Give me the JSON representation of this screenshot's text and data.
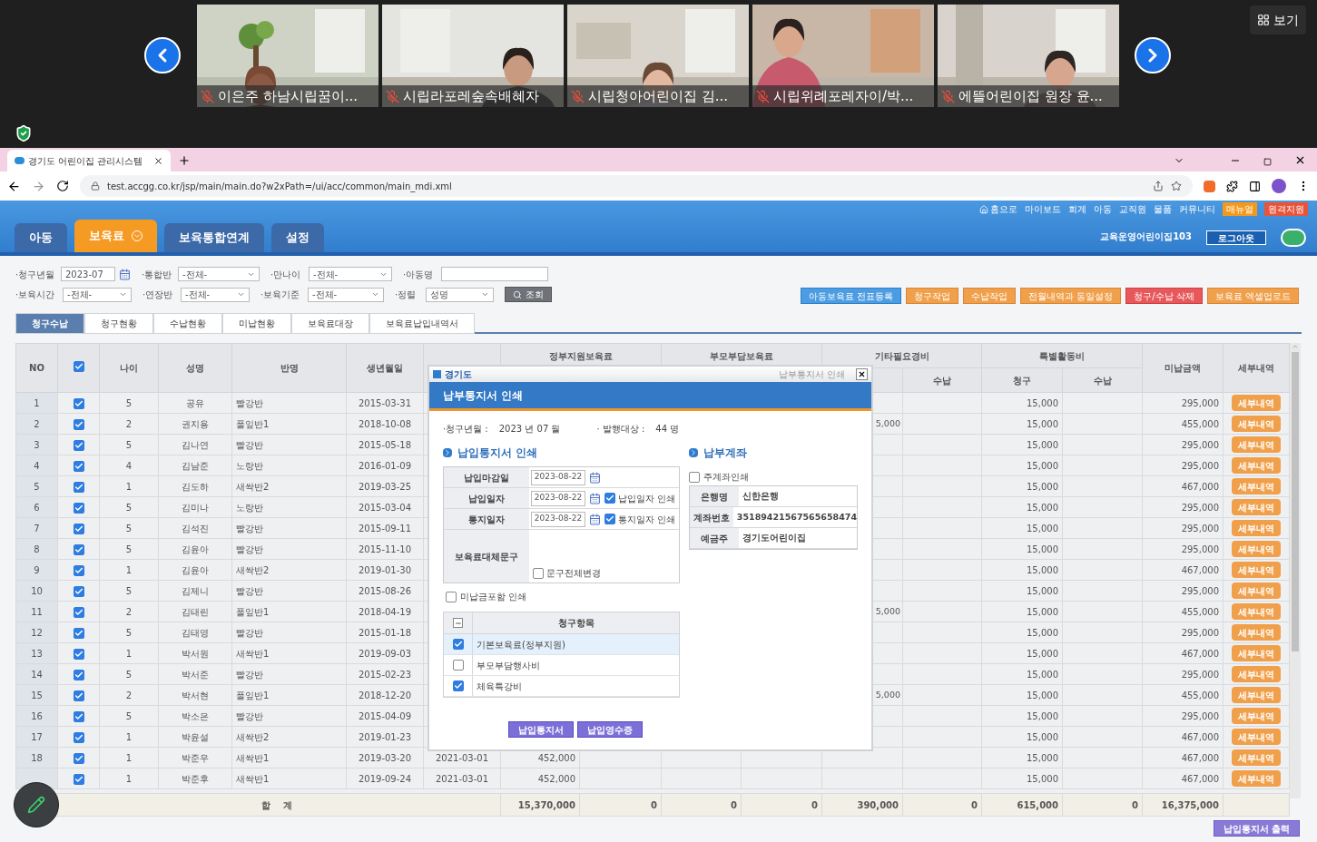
{
  "video_strip": {
    "tiles": [
      {
        "name": "이은주 하남시립꿈이...",
        "muted": true
      },
      {
        "name": "시립라포레숲속배혜자",
        "muted": true
      },
      {
        "name": "시립청아어린이집 김...",
        "muted": true
      },
      {
        "name": "시립위례포레자이/박...",
        "muted": true
      },
      {
        "name": "에뜰어린이집 원장 윤...",
        "muted": true
      }
    ],
    "view_button": "보기"
  },
  "browser": {
    "tab_title": "경기도 어린이집 관리시스템",
    "url": "test.accgg.co.kr/jsp/main/main.do?w2xPath=/ui/acc/common/main_mdi.xml"
  },
  "top_links": [
    {
      "label": "홈으로",
      "kind": "home"
    },
    {
      "label": "마이보드",
      "kind": "plain"
    },
    {
      "label": "회계",
      "kind": "plain"
    },
    {
      "label": "아동",
      "kind": "plain"
    },
    {
      "label": "교직원",
      "kind": "plain"
    },
    {
      "label": "물품",
      "kind": "plain"
    },
    {
      "label": "커뮤니티",
      "kind": "plain"
    },
    {
      "label": "매뉴얼",
      "kind": "orange"
    },
    {
      "label": "원격지원",
      "kind": "red"
    }
  ],
  "main_tabs": [
    {
      "label": "아동",
      "selected": false
    },
    {
      "label": "보육료",
      "selected": true
    },
    {
      "label": "보육통합연계",
      "selected": false
    },
    {
      "label": "설정",
      "selected": false
    }
  ],
  "org_name": "교육운영어린이집103",
  "logout": "로그아웃",
  "filters": [
    [
      {
        "label": "·청구년월",
        "kind": "month",
        "value": "2023-07"
      },
      {
        "label": "·통합반",
        "kind": "select",
        "value": "-전체-"
      },
      {
        "label": "·만나이",
        "kind": "select",
        "value": "-전체-"
      },
      {
        "label": "·아동명",
        "kind": "text"
      }
    ],
    [
      {
        "label": "·보육시간",
        "kind": "select",
        "value": "-전체-"
      },
      {
        "label": "·연장반",
        "kind": "select",
        "value": "-전체-"
      },
      {
        "label": "·보육기준",
        "kind": "select",
        "value": "-전체-"
      },
      {
        "label": "·정렬",
        "kind": "select",
        "value": "성명"
      }
    ]
  ],
  "search_button": "조회",
  "action_buttons": [
    {
      "label": "아동보육료 전표등록",
      "kind": "blue"
    },
    {
      "label": "청구작업",
      "kind": "orange"
    },
    {
      "label": "수납작업",
      "kind": "orange"
    },
    {
      "label": "전월내역과 동일설정",
      "kind": "orange"
    },
    {
      "label": "청구/수납 삭제",
      "kind": "red"
    },
    {
      "label": "보육료 엑셀업로드",
      "kind": "orange"
    }
  ],
  "sub_tabs": [
    {
      "label": "청구수납",
      "selected": true
    },
    {
      "label": "청구현황",
      "selected": false
    },
    {
      "label": "수납현황",
      "selected": false
    },
    {
      "label": "미납현황",
      "selected": false
    },
    {
      "label": "보육료대장",
      "selected": false
    },
    {
      "label": "보육료납입내역서",
      "selected": false
    }
  ],
  "table": {
    "columns": {
      "no": "NO",
      "select_all_checked": true,
      "age": "나이",
      "name": "성명",
      "class": "반명",
      "birth": "생년월일",
      "gov": "정부지원보육료",
      "parent": "부모부담보육료",
      "etc": "기타필요경비",
      "etc_paid": "수납",
      "special": "특별활동비",
      "special_charge": "청구",
      "special_paid": "수납",
      "unpaid": "미납금액",
      "detail": "세부내역"
    },
    "rows": [
      {
        "no": "1",
        "checked": true,
        "age": "5",
        "name": "공유",
        "class": "빨강반",
        "birth": "2015-03-31",
        "special_charge": "15,000",
        "unpaid": "295,000",
        "detail": "세부내역"
      },
      {
        "no": "2",
        "checked": true,
        "age": "2",
        "name": "권지용",
        "class": "풀잎반1",
        "birth": "2018-10-08",
        "etc_charge": "5,000",
        "special_charge": "15,000",
        "unpaid": "455,000",
        "detail": "세부내역"
      },
      {
        "no": "3",
        "checked": true,
        "age": "5",
        "name": "김나연",
        "class": "빨강반",
        "birth": "2015-05-18",
        "special_charge": "15,000",
        "unpaid": "295,000",
        "detail": "세부내역"
      },
      {
        "no": "4",
        "checked": true,
        "age": "4",
        "name": "김남준",
        "class": "노랑반",
        "birth": "2016-01-09",
        "special_charge": "15,000",
        "unpaid": "295,000",
        "detail": "세부내역"
      },
      {
        "no": "5",
        "checked": true,
        "age": "1",
        "name": "김도하",
        "class": "새싹반2",
        "birth": "2019-03-25",
        "special_charge": "15,000",
        "unpaid": "467,000",
        "detail": "세부내역"
      },
      {
        "no": "6",
        "checked": true,
        "age": "5",
        "name": "김미나",
        "class": "노랑반",
        "birth": "2015-03-04",
        "special_charge": "15,000",
        "unpaid": "295,000",
        "detail": "세부내역"
      },
      {
        "no": "7",
        "checked": true,
        "age": "5",
        "name": "김석진",
        "class": "빨강반",
        "birth": "2015-09-11",
        "special_charge": "15,000",
        "unpaid": "295,000",
        "detail": "세부내역"
      },
      {
        "no": "8",
        "checked": true,
        "age": "5",
        "name": "김윤아",
        "class": "빨강반",
        "birth": "2015-11-10",
        "special_charge": "15,000",
        "unpaid": "295,000",
        "detail": "세부내역"
      },
      {
        "no": "9",
        "checked": true,
        "age": "1",
        "name": "김윤아",
        "class": "새싹반2",
        "birth": "2019-01-30",
        "special_charge": "15,000",
        "unpaid": "467,000",
        "detail": "세부내역"
      },
      {
        "no": "10",
        "checked": true,
        "age": "5",
        "name": "김제니",
        "class": "빨강반",
        "birth": "2015-08-26",
        "special_charge": "15,000",
        "unpaid": "295,000",
        "detail": "세부내역"
      },
      {
        "no": "11",
        "checked": true,
        "age": "2",
        "name": "김태린",
        "class": "풀잎반1",
        "birth": "2018-04-19",
        "etc_charge": "5,000",
        "special_charge": "15,000",
        "unpaid": "455,000",
        "detail": "세부내역"
      },
      {
        "no": "12",
        "checked": true,
        "age": "5",
        "name": "김태영",
        "class": "빨강반",
        "birth": "2015-01-18",
        "special_charge": "15,000",
        "unpaid": "295,000",
        "detail": "세부내역"
      },
      {
        "no": "13",
        "checked": true,
        "age": "1",
        "name": "박서원",
        "class": "새싹반1",
        "birth": "2019-09-03",
        "special_charge": "15,000",
        "unpaid": "467,000",
        "detail": "세부내역"
      },
      {
        "no": "14",
        "checked": true,
        "age": "5",
        "name": "박서준",
        "class": "빨강반",
        "birth": "2015-02-23",
        "special_charge": "15,000",
        "unpaid": "295,000",
        "detail": "세부내역"
      },
      {
        "no": "15",
        "checked": true,
        "age": "2",
        "name": "박서현",
        "class": "풀잎반1",
        "birth": "2018-12-20",
        "etc_charge": "5,000",
        "special_charge": "15,000",
        "unpaid": "455,000",
        "detail": "세부내역"
      },
      {
        "no": "16",
        "checked": true,
        "age": "5",
        "name": "박소은",
        "class": "빨강반",
        "birth": "2015-04-09",
        "special_charge": "15,000",
        "unpaid": "295,000",
        "detail": "세부내역"
      },
      {
        "no": "17",
        "checked": true,
        "age": "1",
        "name": "박윤설",
        "class": "새싹반2",
        "birth": "2019-01-23",
        "special_charge": "15,000",
        "unpaid": "467,000",
        "detail": "세부내역"
      },
      {
        "no": "18",
        "checked": true,
        "age": "1",
        "name": "박준우",
        "class": "새싹반1",
        "birth": "2019-03-20",
        "column_7": "2021-03-01",
        "gov_charge": "452,000",
        "special_charge": "15,000",
        "unpaid": "467,000",
        "detail": "세부내역"
      },
      {
        "checked": true,
        "age": "1",
        "name": "박준후",
        "class": "새싹반1",
        "birth": "2019-09-24",
        "column_7": "2021-03-01",
        "gov_charge": "452,000",
        "special_charge": "15,000",
        "unpaid": "467,000",
        "detail": "세부내역"
      }
    ],
    "totals": {
      "label": "합 계",
      "values": [
        "15,370,000",
        "0",
        "0",
        "0",
        "390,000",
        "0",
        "615,000",
        "0",
        "16,375,000"
      ]
    }
  },
  "print_button": "납입통지서 출력",
  "dialog": {
    "brand": "경기도",
    "window_title": "납부통지서 인쇄",
    "heading": "납부통지서 인쇄",
    "summary": [
      {
        "label": "·청구년월 :",
        "value": "2023 년 07 월"
      },
      {
        "label": "· 발행대상 :",
        "value": "44 명"
      }
    ],
    "print_section": {
      "title": "납입통지서 인쇄",
      "rows": [
        {
          "label": "납입마감일",
          "date": "2023-08-22"
        },
        {
          "label": "납입일자",
          "date": "2023-08-22",
          "option": {
            "label": "납입일자 인쇄",
            "checked": true
          }
        },
        {
          "label": "통지일자",
          "date": "2023-08-22",
          "option": {
            "label": "통지일자 인쇄",
            "checked": true
          }
        }
      ],
      "memo": {
        "label": "보육료대체문구",
        "option": {
          "label": "문구전체변경",
          "checked": false
        }
      },
      "include_unpaid": {
        "label": "미납금포함 인쇄",
        "checked": false
      },
      "items_header": "청구항목",
      "items": [
        {
          "label": "기본보육료(정부지원)",
          "checked": true,
          "selected": true
        },
        {
          "label": "부모부담행사비",
          "checked": false,
          "selected": false
        },
        {
          "label": "체육특강비",
          "checked": true,
          "selected": false
        }
      ]
    },
    "account_section": {
      "title": "납부계좌",
      "main_account": {
        "label": "주계좌인쇄",
        "checked": false
      },
      "rows": [
        {
          "label": "은행명",
          "value": "신한은행"
        },
        {
          "label": "계좌번호",
          "value": "35189421567565658474"
        },
        {
          "label": "예금주",
          "value": "경기도어린이집"
        }
      ]
    },
    "buttons": [
      "납입통지서",
      "납입영수증"
    ]
  }
}
